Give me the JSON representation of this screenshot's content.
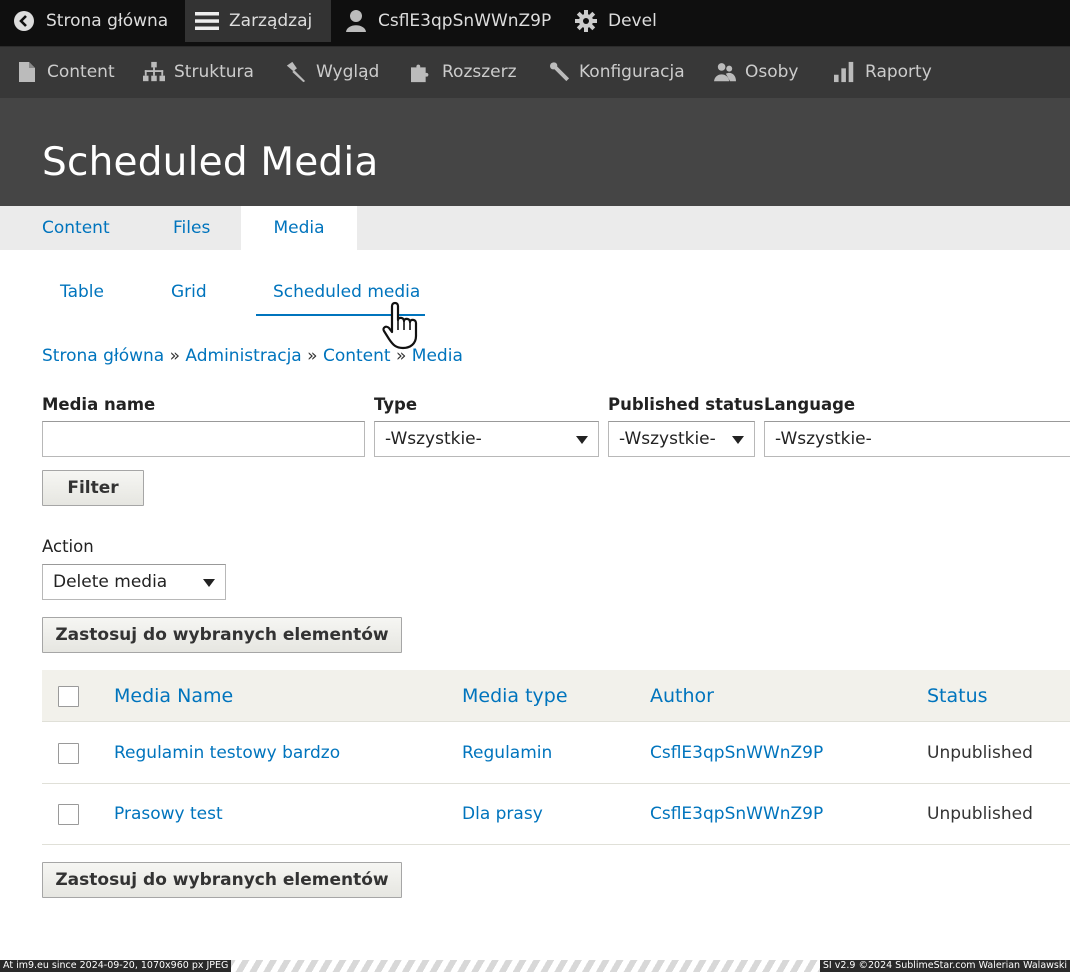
{
  "toolbar_top": {
    "home": "Strona główna",
    "manage": "Zarządzaj",
    "user": "CsflE3qpSnWWnZ9P",
    "devel": "Devel"
  },
  "toolbar_admin": {
    "items": [
      "Content",
      "Struktura",
      "Wygląd",
      "Rozszerz",
      "Konfiguracja",
      "Osoby",
      "Raporty"
    ]
  },
  "page_title": "Scheduled Media",
  "primary_tabs": [
    "Content",
    "Files",
    "Media"
  ],
  "primary_active": "Media",
  "secondary_tabs": [
    "Table",
    "Grid",
    "Scheduled media"
  ],
  "secondary_active": "Scheduled media",
  "breadcrumb": [
    "Strona główna",
    "Administracja",
    "Content",
    "Media"
  ],
  "breadcrumb_separator": "»",
  "filters": {
    "media_name_label": "Media name",
    "media_name_value": "",
    "type_label": "Type",
    "type_value": "-Wszystkie-",
    "status_label": "Published status",
    "status_value": "-Wszystkie-",
    "language_label": "Language",
    "language_value": "-Wszystkie-",
    "filter_button": "Filter"
  },
  "bulk": {
    "action_label": "Action",
    "action_value": "Delete media",
    "apply_button": "Zastosuj do wybranych elementów"
  },
  "table": {
    "headers": [
      "Media Name",
      "Media type",
      "Author",
      "Status"
    ],
    "rows": [
      {
        "name": "Regulamin testowy bardzo",
        "type": "Regulamin",
        "author": "CsflE3qpSnWWnZ9P",
        "status": "Unpublished"
      },
      {
        "name": "Prasowy test",
        "type": "Dla prasy",
        "author": "CsflE3qpSnWWnZ9P",
        "status": "Unpublished"
      }
    ]
  },
  "footer": {
    "left": "At im9.eu since 2024-09-20, 1070x960 px JPEG",
    "right": "SI v2.9 ©2024 SublimeStar.com Walerian Walawski"
  },
  "colors": {
    "link": "#0074bd",
    "toolbar_dark": "#0f0f0f",
    "toolbar_secondary": "#383838",
    "header": "#454545"
  }
}
